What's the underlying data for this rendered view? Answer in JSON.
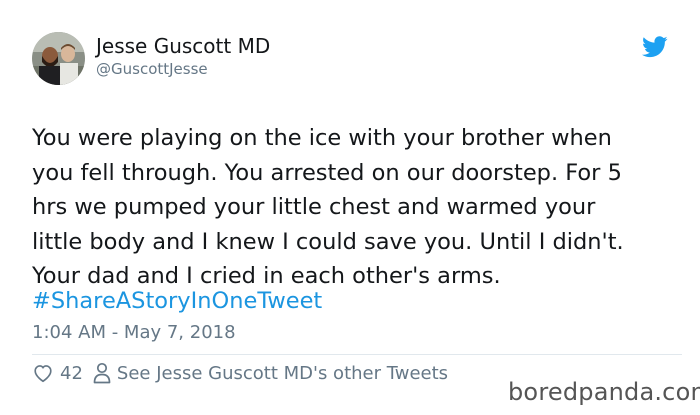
{
  "tweet": {
    "author_name": "Jesse Guscott MD",
    "author_handle": "@GuscottJesse",
    "avatar_icon": "profile-photo",
    "brand_icon": "twitter-bird-icon",
    "body": "You were playing on the ice with your brother when\nyou fell through. You arrested on our doorstep. For 5\nhrs we pumped your little chest and warmed your\nlittle body and I knew I could save you. Until I didn't.\nYour dad and I cried in each other's arms.",
    "hashtag": "#ShareAStoryInOneTweet",
    "timestamp": "1:04 AM - May 7, 2018",
    "like_count": "42",
    "other_tweets_link": "See Jesse Guscott MD's other Tweets"
  },
  "watermark": "boredpanda.com",
  "colors": {
    "link": "#1b95e0",
    "text": "#14171a",
    "muted": "#657786",
    "twitter_blue": "#1da1f2"
  }
}
